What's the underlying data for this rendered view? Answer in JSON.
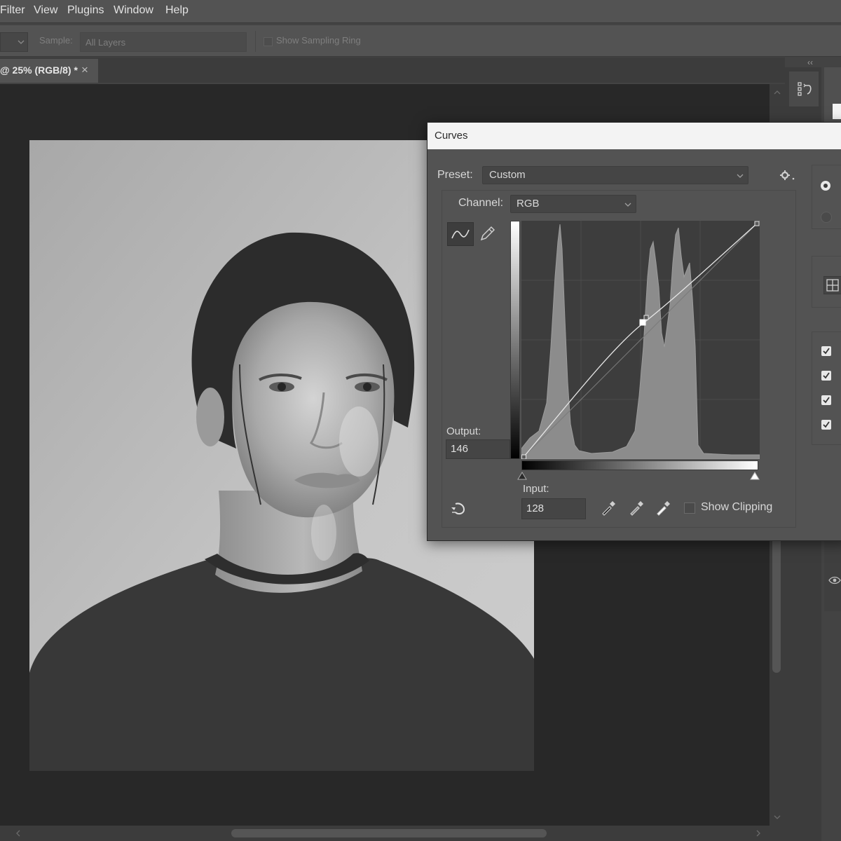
{
  "menu": {
    "items": [
      {
        "label": "Filter"
      },
      {
        "label": "View"
      },
      {
        "label": "Plugins"
      },
      {
        "label": "Window"
      },
      {
        "label": "Help"
      }
    ]
  },
  "options_bar": {
    "sample_label": "Sample:",
    "sample_value": "All Layers",
    "show_sampling_ring": "Show Sampling Ring"
  },
  "document": {
    "tab_title": "@ 25% (RGB/8) *",
    "close_glyph": "×"
  },
  "panels": {
    "collapse_glyph": "‹‹"
  },
  "curves": {
    "title": "Curves",
    "preset_label": "Preset:",
    "preset_value": "Custom",
    "channel_label": "Channel:",
    "channel_value": "RGB",
    "output_label": "Output:",
    "output_value": "146",
    "input_label": "Input:",
    "input_value": "128",
    "show_clipping_label": "Show Clipping",
    "show_clipping_checked": false,
    "curve_point": {
      "input": 128,
      "output": 146
    },
    "icons": [
      "curve-tool-icon",
      "pencil-icon",
      "gear-icon",
      "targeted-adjustment-icon",
      "black-eyedropper-icon",
      "gray-eyedropper-icon",
      "white-eyedropper-icon"
    ]
  },
  "right_options": {
    "checkboxes_checked": [
      true,
      true,
      true,
      true
    ]
  }
}
